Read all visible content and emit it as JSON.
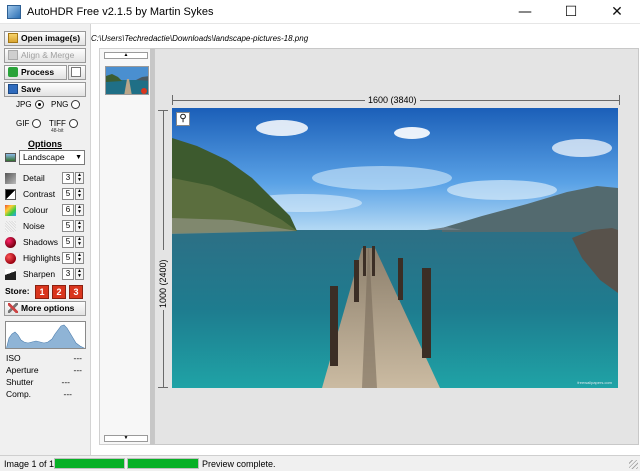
{
  "window": {
    "title": "AutoHDR Free v2.1.5 by Martin Sykes",
    "minimize_glyph": "—",
    "maximize_glyph": "☐",
    "close_glyph": "✕"
  },
  "toolbar": {
    "open_label": "Open image(s)",
    "align_label": "Align & Merge",
    "process_label": "Process",
    "save_label": "Save"
  },
  "formats": {
    "jpg": "JPG",
    "png": "PNG",
    "gif": "GIF",
    "tiff": "TIFF",
    "tiff_sub": "48-bit",
    "selected": "JPG"
  },
  "options": {
    "heading": "Options",
    "preset": "Landscape",
    "sliders": [
      {
        "label": "Detail",
        "value": "3",
        "icon": "detail-icon"
      },
      {
        "label": "Contrast",
        "value": "5",
        "icon": "contrast-icon"
      },
      {
        "label": "Colour",
        "value": "6",
        "icon": "colour-icon"
      },
      {
        "label": "Noise",
        "value": "5",
        "icon": "noise-icon"
      },
      {
        "label": "Shadows",
        "value": "5",
        "icon": "shadows-icon"
      },
      {
        "label": "Highlights",
        "value": "5",
        "icon": "highlights-icon"
      },
      {
        "label": "Sharpen",
        "value": "3",
        "icon": "sharpen-icon"
      }
    ],
    "store_label": "Store:",
    "store_slots": [
      "1",
      "2",
      "3"
    ],
    "more_label": "More options"
  },
  "exif": [
    {
      "label": "ISO",
      "value": "---"
    },
    {
      "label": "Aperture",
      "value": "---"
    },
    {
      "label": "Shutter",
      "value": "---"
    },
    {
      "label": "Comp.",
      "value": "---"
    }
  ],
  "file_path": "C:\\Users\\Techredactie\\Downloads\\landscape-pictures-18.png",
  "preview": {
    "width_label": "1600 (3840)",
    "height_label": "1000 (2400)",
    "watermark": "freewallpapers.com"
  },
  "status": {
    "image_count": "Image 1 of 1",
    "progress": [
      1.0,
      1.0
    ],
    "message": "Preview complete."
  },
  "colors": {
    "progress_green": "#06b025",
    "store_red": "#d9351d"
  }
}
